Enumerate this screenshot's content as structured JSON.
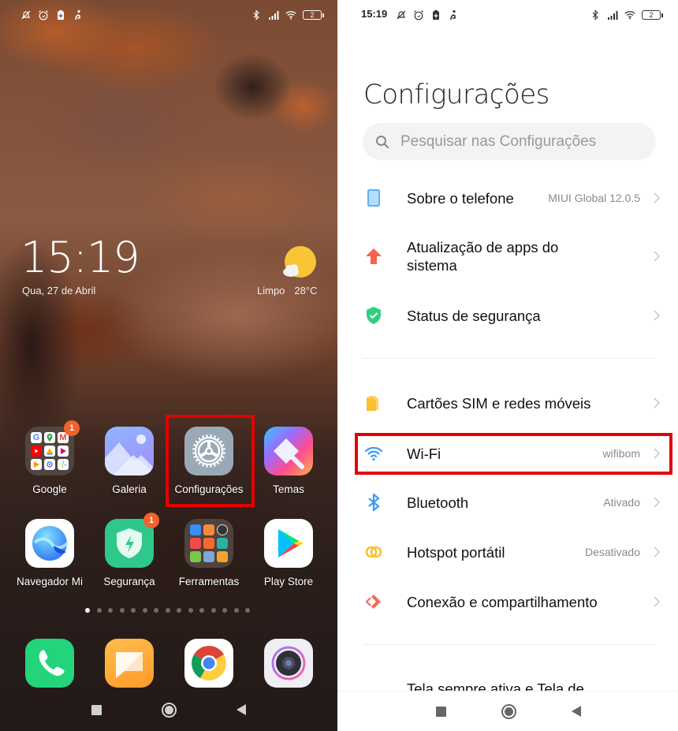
{
  "home_screen": {
    "status_bar": {
      "left_icons": [
        "bell-off-icon",
        "alarm-icon",
        "battery-saver-icon",
        "accessibility-icon"
      ],
      "right_icons": [
        "bluetooth-icon",
        "signal-icon",
        "wifi-icon"
      ],
      "battery_level": "2"
    },
    "clock_widget": {
      "time": "15:19",
      "date": "Qua, 27 de Abril",
      "weather_condition": "Limpo",
      "temperature": "28°C",
      "weather_icon": "sun-cloud-icon"
    },
    "apps_row1": [
      {
        "label": "Google",
        "icon": "google-folder-icon",
        "badge": "1"
      },
      {
        "label": "Galeria",
        "icon": "gallery-icon",
        "badge": null
      },
      {
        "label": "Configurações",
        "icon": "settings-gear-icon",
        "badge": null,
        "highlighted": true
      },
      {
        "label": "Temas",
        "icon": "themes-brush-icon",
        "badge": null
      }
    ],
    "apps_row2": [
      {
        "label": "Navegador Mi",
        "icon": "mi-browser-icon",
        "badge": null
      },
      {
        "label": "Segurança",
        "icon": "security-shield-icon",
        "badge": "1"
      },
      {
        "label": "Ferramentas",
        "icon": "tools-folder-icon",
        "badge": null
      },
      {
        "label": "Play Store",
        "icon": "play-store-icon",
        "badge": null
      }
    ],
    "page_indicator": {
      "total": 15,
      "active": 1
    },
    "dock": [
      {
        "icon": "phone-icon"
      },
      {
        "icon": "messages-icon"
      },
      {
        "icon": "chrome-icon"
      },
      {
        "icon": "camera-icon"
      }
    ],
    "nav": [
      "recents-button",
      "home-button",
      "back-button"
    ],
    "highlight_color": "#e50000"
  },
  "settings_screen": {
    "status_bar": {
      "time": "15:19",
      "battery_level": "2"
    },
    "title": "Configurações",
    "search": {
      "placeholder": "Pesquisar nas Configurações",
      "value": ""
    },
    "groups": [
      [
        {
          "label": "Sobre o telefone",
          "value": "MIUI Global 12.0.5",
          "icon": "phone-info-icon",
          "color": "#5ab4f0"
        },
        {
          "label": "Atualização de apps do sistema",
          "value": "",
          "icon": "update-arrow-icon",
          "color": "#f7634f"
        },
        {
          "label": "Status de segurança",
          "value": "",
          "icon": "security-check-icon",
          "color": "#2fcf7e"
        }
      ],
      [
        {
          "label": "Cartões SIM e redes móveis",
          "value": "",
          "icon": "sim-card-icon",
          "color": "#fbbf32"
        },
        {
          "label": "Wi-Fi",
          "value": "wifibom",
          "icon": "wifi-icon",
          "color": "#3a9bf5",
          "highlighted": true
        },
        {
          "label": "Bluetooth",
          "value": "Ativado",
          "icon": "bluetooth-icon",
          "color": "#3a9bf5"
        },
        {
          "label": "Hotspot portátil",
          "value": "Desativado",
          "icon": "hotspot-icon",
          "color": "#f5c234"
        },
        {
          "label": "Conexão e compartilhamento",
          "value": "",
          "icon": "connection-share-icon",
          "color": "#f26b5b"
        }
      ],
      [
        {
          "label": "Tela sempre ativa e Tela de",
          "value": "",
          "icon": "always-on-display-icon",
          "color": "#f26b5b"
        }
      ]
    ]
  }
}
